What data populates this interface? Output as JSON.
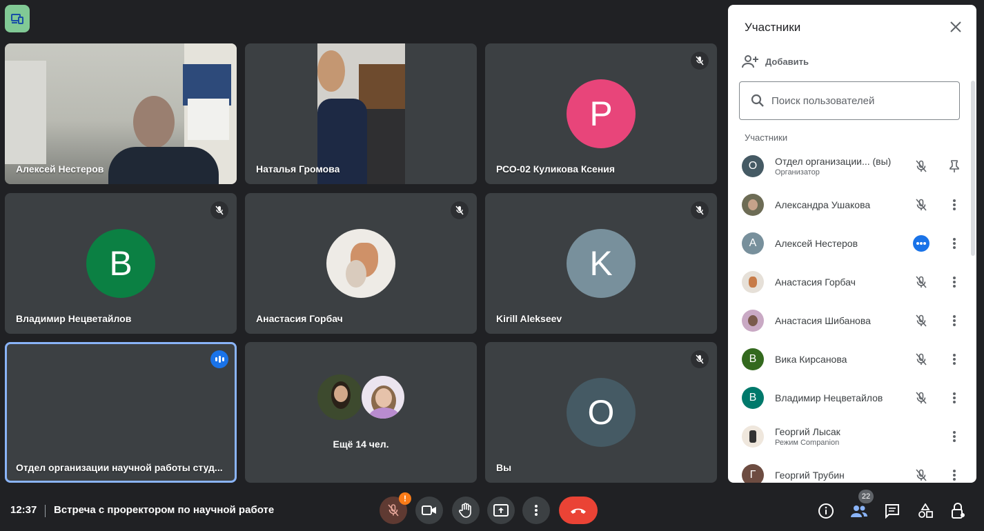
{
  "tiles": [
    {
      "name": "Алексей Нестеров",
      "type": "video"
    },
    {
      "name": "Наталья Громова",
      "type": "video"
    },
    {
      "name": "РСО-02 Куликова Ксения",
      "initial": "P",
      "color": "#e8457a",
      "muted": true
    },
    {
      "name": "Владимир Нецветайлов",
      "initial": "B",
      "color": "#0b8043",
      "muted": true
    },
    {
      "name": "Анастасия Горбач",
      "type": "avatar-image",
      "muted": true
    },
    {
      "name": "Kirill Alekseev",
      "initial": "K",
      "color": "#78909c",
      "muted": true
    },
    {
      "name": "Отдел организации научной работы студ...",
      "type": "video",
      "speaking": true
    },
    {
      "more_label": "Ещё 14 чел."
    },
    {
      "name": "Вы",
      "initial": "O",
      "color": "#455a64",
      "muted": true
    }
  ],
  "panel": {
    "title": "Участники",
    "add_label": "Добавить",
    "search_placeholder": "Поиск пользователей",
    "section_label": "Участники",
    "participants": [
      {
        "initial": "O",
        "color": "#455a64",
        "name": "Отдел организации... (вы)",
        "sub": "Организатор",
        "action": "pin-icon"
      },
      {
        "initial": "",
        "color": "#6d6c55",
        "name": "Александра Ушакова"
      },
      {
        "initial": "A",
        "color": "#78909c",
        "name": "Алексей Нестеров",
        "speaking": true
      },
      {
        "initial": "",
        "color": "#d9cfc4",
        "name": "Анастасия Горбач"
      },
      {
        "initial": "",
        "color": "#b28fa8",
        "name": "Анастасия Шибанова"
      },
      {
        "initial": "B",
        "color": "#33691e",
        "name": "Вика Кирсанова"
      },
      {
        "initial": "B",
        "color": "#00796b",
        "name": "Владимир Нецветайлов"
      },
      {
        "initial": "",
        "color": "#efe7dd",
        "name": "Георгий Лысак",
        "sub": "Режим Companion",
        "no_mic": true
      },
      {
        "initial": "Г",
        "color": "#6d4c41",
        "name": "Георгий Трубин"
      }
    ]
  },
  "bottom": {
    "time": "12:37",
    "meeting_title": "Встреча с проректором по научной работе",
    "warning_badge": "!",
    "participant_count": "22"
  }
}
